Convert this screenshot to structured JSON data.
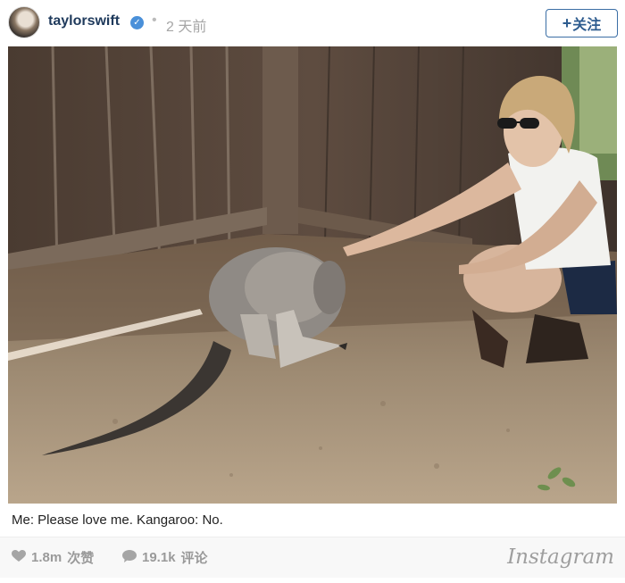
{
  "post": {
    "username": "taylorswift",
    "time": "2 天前",
    "follow_label": "关注",
    "caption": "Me: Please love me. Kangaroo: No.",
    "likes": "1.8m",
    "likes_label": "次赞",
    "comments": "19.1k",
    "comments_label": "评论",
    "brand": "Instagram"
  },
  "icons": {
    "verified": "verified-check-icon",
    "like": "heart-icon",
    "comment": "speech-bubble-icon",
    "follow": "plus-icon"
  },
  "colors": {
    "username": "#1f3a5c",
    "verified": "#4a90d9",
    "follow_border": "#3b6ea5",
    "stat_text": "#9a9a9a"
  }
}
